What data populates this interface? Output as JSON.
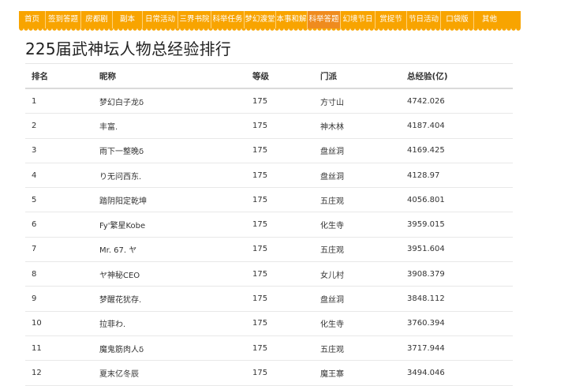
{
  "nav": {
    "items": [
      "首页",
      "签到答题",
      "房都剧",
      "副本",
      "日常活动",
      "三界书院",
      "科举任务",
      "梦幻渡堂",
      "本事和解",
      "科举答题",
      "幻境节日",
      "赏捉节",
      "节日活动",
      "口袋版",
      "其他"
    ],
    "active_index": 9
  },
  "page": {
    "title": "225届武神坛人物总经验排行"
  },
  "table": {
    "headers": [
      "排名",
      "昵称",
      "等级",
      "门派",
      "总经验(亿)"
    ],
    "rows": [
      {
        "rank": "1",
        "name": "梦幻白子龙δ",
        "level": "175",
        "school": "方寸山",
        "exp": "4742.026"
      },
      {
        "rank": "2",
        "name": "丰富.",
        "level": "175",
        "school": "神木林",
        "exp": "4187.404"
      },
      {
        "rank": "3",
        "name": "雨下一整晚δ",
        "level": "175",
        "school": "盘丝洞",
        "exp": "4169.425"
      },
      {
        "rank": "4",
        "name": "り无问西东.",
        "level": "175",
        "school": "盘丝洞",
        "exp": "4128.97"
      },
      {
        "rank": "5",
        "name": "踏阴阳定乾坤",
        "level": "175",
        "school": "五庄观",
        "exp": "4056.801"
      },
      {
        "rank": "6",
        "name": "Fy'繁星Kobe",
        "level": "175",
        "school": "化生寺",
        "exp": "3959.015"
      },
      {
        "rank": "7",
        "name": "Mr. 67. ヤ",
        "level": "175",
        "school": "五庄观",
        "exp": "3951.604"
      },
      {
        "rank": "8",
        "name": "ヤ神秘CEO",
        "level": "175",
        "school": "女儿村",
        "exp": "3908.379"
      },
      {
        "rank": "9",
        "name": "梦醒花犹存.",
        "level": "175",
        "school": "盘丝洞",
        "exp": "3848.112"
      },
      {
        "rank": "10",
        "name": "拉菲わ.",
        "level": "175",
        "school": "化生寺",
        "exp": "3760.394"
      },
      {
        "rank": "11",
        "name": "魔鬼筋肉人δ",
        "level": "175",
        "school": "五庄观",
        "exp": "3717.944"
      },
      {
        "rank": "12",
        "name": "夏末亿冬辰",
        "level": "175",
        "school": "魔王寨",
        "exp": "3494.046"
      }
    ]
  }
}
